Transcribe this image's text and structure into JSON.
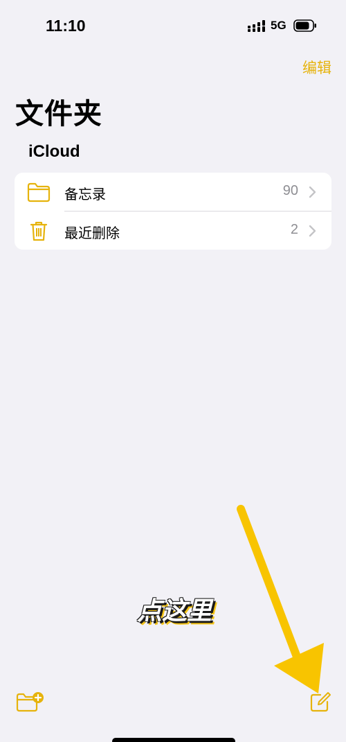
{
  "status_bar": {
    "time": "11:10",
    "network": "5G",
    "icons": [
      "signal-icon",
      "battery-icon"
    ]
  },
  "nav": {
    "edit_label": "编辑",
    "title": "文件夹"
  },
  "section": {
    "title": "iCloud"
  },
  "folders": [
    {
      "icon": "folder-icon",
      "label": "备忘录",
      "count": "90"
    },
    {
      "icon": "trash-icon",
      "label": "最近删除",
      "count": "2"
    }
  ],
  "annotation": {
    "text": "点这里",
    "arrow_color": "#f8c400"
  },
  "toolbar": {
    "left_icon": "new-folder-icon",
    "right_icon": "compose-icon"
  },
  "colors": {
    "accent": "#e6b30c",
    "background": "#f2f1f6",
    "card": "#ffffff",
    "secondary_text": "#8e8e93"
  }
}
